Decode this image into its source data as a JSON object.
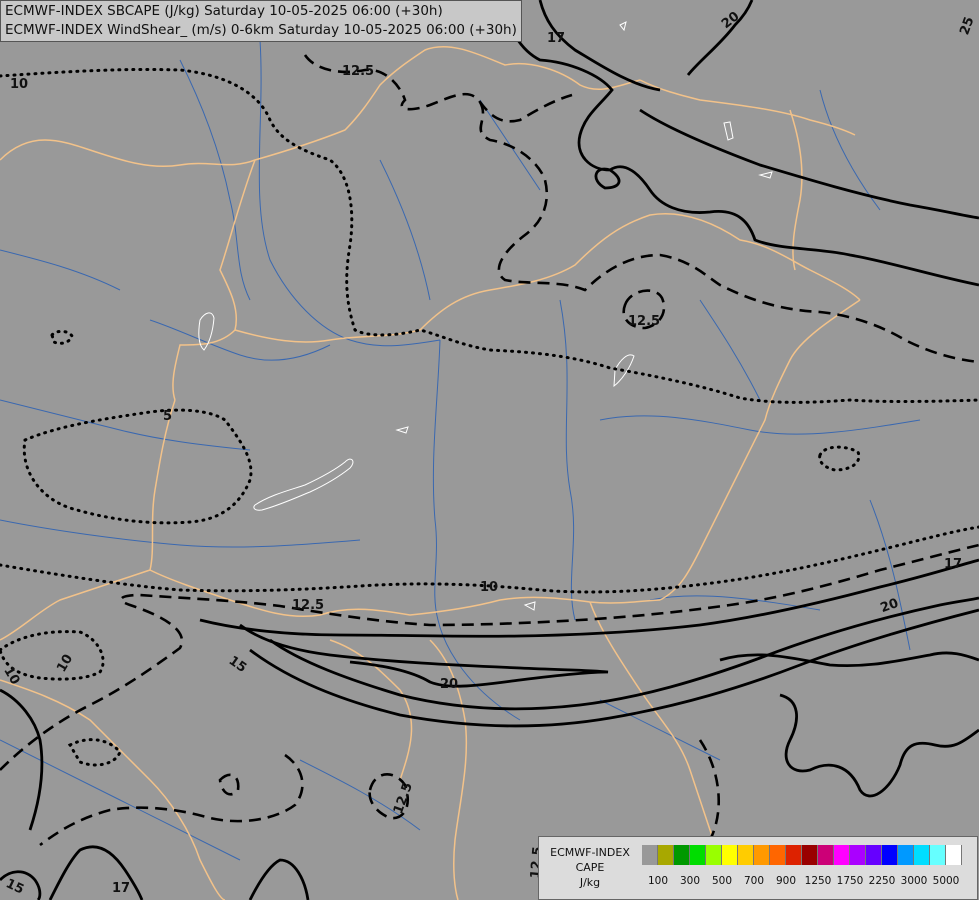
{
  "titles": {
    "line1": "ECMWF-INDEX SBCAPE (J/kg) Saturday 10-05-2025 06:00 (+30h)",
    "line2": "ECMWF-INDEX WindShear_ (m/s) 0-6km Saturday 10-05-2025 06:00 (+30h)"
  },
  "map": {
    "background": "#999999",
    "border_color": "#f2c28a",
    "river_color": "#3a68b0",
    "lake_color": "#ffffff",
    "contour_color": "#000000"
  },
  "contour_labels": [
    "10",
    "12.5",
    "17",
    "20",
    "25",
    "12.5",
    "5",
    "10",
    "12.5",
    "17",
    "20",
    "15",
    "20",
    "10",
    "10",
    "12.5",
    "15",
    "17",
    "12.5"
  ],
  "legend": {
    "title_line1": "ECMWF-INDEX",
    "title_line2": "CAPE",
    "title_line3": "J/kg",
    "colors": [
      "#999999",
      "#a8a800",
      "#009900",
      "#00dd00",
      "#99ff00",
      "#ffff00",
      "#ffcc00",
      "#ff9900",
      "#ff6600",
      "#dd2200",
      "#990000",
      "#cc0077",
      "#ff00ff",
      "#aa00ff",
      "#6600ff",
      "#0000ff",
      "#0099ff",
      "#00ddff",
      "#66ffff",
      "#ffffff"
    ],
    "ticks": [
      "100",
      "300",
      "500",
      "700",
      "900",
      "1250",
      "1750",
      "2250",
      "3000",
      "5000"
    ]
  }
}
